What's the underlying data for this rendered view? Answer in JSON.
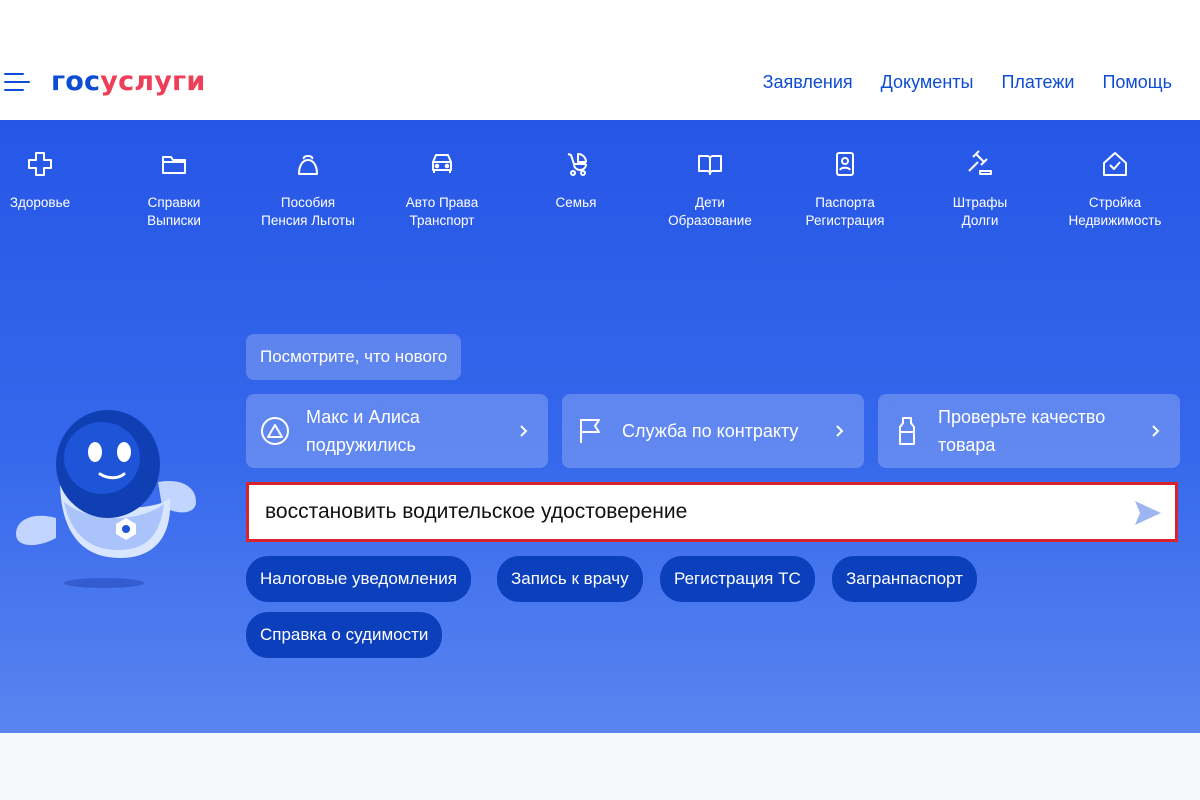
{
  "header": {
    "logo_part1": "гос",
    "logo_part2": "услуги",
    "nav": [
      "Заявления",
      "Документы",
      "Платежи",
      "Помощь"
    ]
  },
  "categories": [
    {
      "line1": "Здоровье",
      "line2": "",
      "icon": "health-cross-icon"
    },
    {
      "line1": "Справки",
      "line2": "Выписки",
      "icon": "folder-icon"
    },
    {
      "line1": "Пособия",
      "line2": "Пенсия Льготы",
      "icon": "purse-icon"
    },
    {
      "line1": "Авто Права",
      "line2": "Транспорт",
      "icon": "car-icon"
    },
    {
      "line1": "Семья",
      "line2": "",
      "icon": "stroller-icon"
    },
    {
      "line1": "Дети",
      "line2": "Образование",
      "icon": "book-icon"
    },
    {
      "line1": "Паспорта",
      "line2": "Регистрация",
      "icon": "passport-icon"
    },
    {
      "line1": "Штрафы",
      "line2": "Долги",
      "icon": "gavel-icon"
    },
    {
      "line1": "Стройка",
      "line2": "Недвижимость",
      "icon": "house-icon"
    }
  ],
  "whats_new": "Посмотрите, что нового",
  "promos": [
    {
      "line1": "Макс и Алиса",
      "line2": "подружились",
      "icon": "alice-icon"
    },
    {
      "line1": "Служба по контракту",
      "line2": "",
      "icon": "flag-icon"
    },
    {
      "line1": "Проверьте качество",
      "line2": "товара",
      "icon": "bottle-icon"
    }
  ],
  "search": {
    "value": "восстановить водительское удостоверение"
  },
  "chips": [
    "Налоговые уведомления",
    "Запись к врачу",
    "Регистрация ТС",
    "Загранпаспорт",
    "Справка о судимости"
  ],
  "colors": {
    "brand_blue": "#0d4cd3",
    "brand_red": "#ee3f58",
    "hero_blue": "#2656e6",
    "chip_blue": "#0b3fbb",
    "search_highlight": "#d8222e"
  }
}
